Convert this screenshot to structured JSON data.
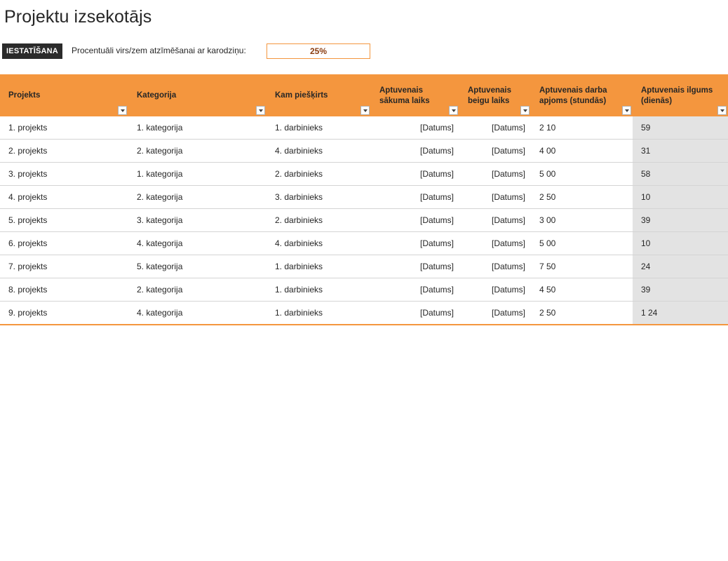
{
  "title": "Projektu izsekotājs",
  "settings": {
    "button_label": "IESTATĪŠANA",
    "label": "Procentuāli virs/zem atzīmēšanai ar karodziņu:",
    "percent_value": "25%"
  },
  "colors": {
    "accent": "#f4963e",
    "header_dark": "#2b2b2b",
    "duration_fill": "#e3e3e3"
  },
  "table": {
    "headers": [
      "Projekts",
      "Kategorija",
      "Kam piešķirts",
      "Aptuvenais sākuma laiks",
      "Aptuvenais beigu laiks",
      "Aptuvenais darba apjoms (stundās)",
      "Aptuvenais ilgums (dienās)"
    ],
    "rows": [
      [
        "1. projekts",
        "1. kategorija",
        "1. darbinieks",
        "[Datums]",
        "[Datums]",
        "2 10",
        "59"
      ],
      [
        "2. projekts",
        "2. kategorija",
        "4. darbinieks",
        "[Datums]",
        "[Datums]",
        "4 00",
        "31"
      ],
      [
        "3. projekts",
        "1. kategorija",
        "2. darbinieks",
        "[Datums]",
        "[Datums]",
        "5 00",
        "58"
      ],
      [
        "4. projekts",
        "2. kategorija",
        "3. darbinieks",
        "[Datums]",
        "[Datums]",
        "2 50",
        "10"
      ],
      [
        "5. projekts",
        "3. kategorija",
        "2. darbinieks",
        "[Datums]",
        "[Datums]",
        "3 00",
        "39"
      ],
      [
        "6. projekts",
        "4. kategorija",
        "4. darbinieks",
        "[Datums]",
        "[Datums]",
        "5 00",
        "10"
      ],
      [
        "7. projekts",
        "5. kategorija",
        "1. darbinieks",
        "[Datums]",
        "[Datums]",
        "7 50",
        "24"
      ],
      [
        "8. projekts",
        "2. kategorija",
        "1. darbinieks",
        "[Datums]",
        "[Datums]",
        "4 50",
        "39"
      ],
      [
        "9. projekts",
        "4. kategorija",
        "1. darbinieks",
        "[Datums]",
        "[Datums]",
        "2 50",
        "1 24"
      ]
    ]
  }
}
